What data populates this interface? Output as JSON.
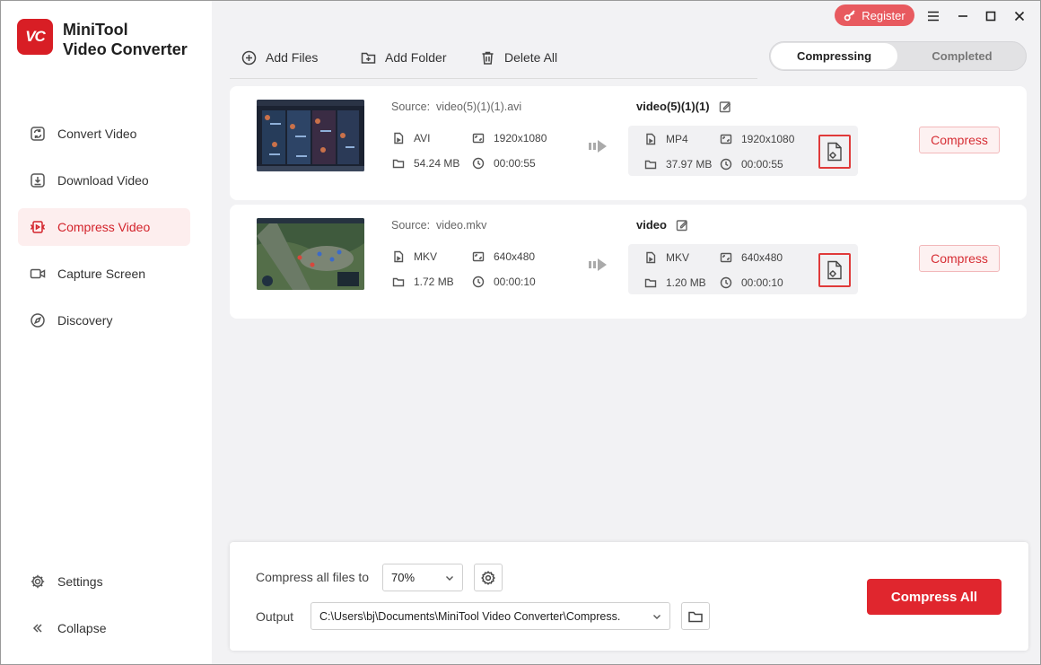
{
  "app": {
    "logo_text": "VC",
    "title_line1": "MiniTool",
    "title_line2": "Video Converter",
    "register_label": "Register",
    "accent": "#e0262e"
  },
  "sidebar": {
    "items": [
      {
        "label": "Convert Video",
        "icon": "convert-icon",
        "active": false
      },
      {
        "label": "Download Video",
        "icon": "download-icon",
        "active": false
      },
      {
        "label": "Compress Video",
        "icon": "compress-icon",
        "active": true
      },
      {
        "label": "Capture Screen",
        "icon": "camera-icon",
        "active": false
      },
      {
        "label": "Discovery",
        "icon": "compass-icon",
        "active": false
      }
    ],
    "settings_label": "Settings",
    "collapse_label": "Collapse"
  },
  "toolbar": {
    "add_files": "Add Files",
    "add_folder": "Add Folder",
    "delete_all": "Delete All"
  },
  "tabs": {
    "compressing": "Compressing",
    "completed": "Completed"
  },
  "files": [
    {
      "source_label": "Source:",
      "source_name": "video(5)(1)(1).avi",
      "src_format": "AVI",
      "src_resolution": "1920x1080",
      "src_size": "54.24 MB",
      "src_duration": "00:00:55",
      "out_name": "video(5)(1)(1)",
      "out_format": "MP4",
      "out_resolution": "1920x1080",
      "out_size": "37.97 MB",
      "out_duration": "00:00:55",
      "compress_label": "Compress"
    },
    {
      "source_label": "Source:",
      "source_name": "video.mkv",
      "src_format": "MKV",
      "src_resolution": "640x480",
      "src_size": "1.72 MB",
      "src_duration": "00:00:10",
      "out_name": "video",
      "out_format": "MKV",
      "out_resolution": "640x480",
      "out_size": "1.20 MB",
      "out_duration": "00:00:10",
      "compress_label": "Compress"
    }
  ],
  "bottom": {
    "compress_all_label_text": "Compress all files to",
    "ratio_value": "70%",
    "output_label": "Output",
    "output_path": "C:\\Users\\bj\\Documents\\MiniTool Video Converter\\Compress.",
    "compress_all_button": "Compress All"
  }
}
